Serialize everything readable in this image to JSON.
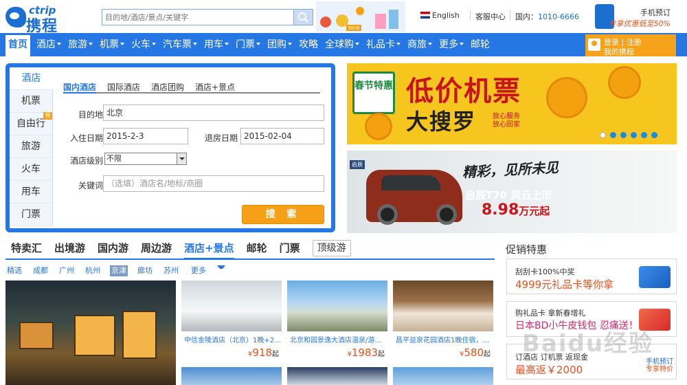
{
  "header": {
    "logo_top": "ctrip",
    "logo_main": "携程",
    "search_placeholder": "目的地/酒店/景点/关键字",
    "new_badge": "NEW",
    "language": "English",
    "service": "客服中心",
    "phone_label": "国内：",
    "phone_number": "1010-6666",
    "mobile_title": "手机预订",
    "mobile_promo": "专享优惠低至50%"
  },
  "nav": {
    "items": [
      {
        "label": "首页",
        "dropdown": false
      },
      {
        "label": "酒店",
        "dropdown": true
      },
      {
        "label": "旅游",
        "dropdown": true
      },
      {
        "label": "机票",
        "dropdown": true
      },
      {
        "label": "火车",
        "dropdown": true
      },
      {
        "label": "汽车票",
        "dropdown": true
      },
      {
        "label": "用车",
        "dropdown": true
      },
      {
        "label": "门票",
        "dropdown": true
      },
      {
        "label": "团购",
        "dropdown": true
      },
      {
        "label": "攻略",
        "dropdown": false
      },
      {
        "label": "全球购",
        "dropdown": true
      },
      {
        "label": "礼品卡",
        "dropdown": true
      },
      {
        "label": "商旅",
        "dropdown": true
      },
      {
        "label": "更多",
        "dropdown": true
      },
      {
        "label": "邮轮",
        "dropdown": false
      }
    ],
    "login": "登录 | 注册",
    "my_ctrip": "我的携程"
  },
  "booking": {
    "vertical_tabs": [
      "酒店",
      "机票",
      "自由行",
      "旅游",
      "火车",
      "用车",
      "门票"
    ],
    "save_tag": "省",
    "tabs": [
      "国内酒店",
      "国际酒店",
      "酒店团购",
      "酒店+景点"
    ],
    "destination_label": "目的地",
    "destination_value": "北京",
    "checkin_label": "入住日期",
    "checkin_value": "2015-2-3",
    "checkout_label": "退房日期",
    "checkout_value": "2015-02-04",
    "level_label": "酒店级别",
    "level_value": "不限",
    "keyword_label": "关键词",
    "keyword_placeholder": "（选填）酒店名/地标/商圈",
    "search_button": "搜 索"
  },
  "banner1": {
    "badge": "春节特惠",
    "title": "低价机票",
    "subtitle": "大搜罗",
    "slogan1": "放心服务",
    "slogan2": "放心回家",
    "active_dot": 0,
    "dots": 6
  },
  "banner2": {
    "brand": "启辰",
    "headline": "精彩，见所未见",
    "model": "启辰T70 风云上市",
    "price": "8.98",
    "price_unit": "万元起"
  },
  "lower": {
    "tabs": [
      "特卖汇",
      "出境游",
      "国内游",
      "周边游",
      "酒店+景点",
      "邮轮",
      "门票",
      "顶级游"
    ],
    "cities": [
      "精选",
      "成都",
      "广州",
      "杭州",
      "京津",
      "廊坊",
      "苏州"
    ],
    "more": "更多",
    "cards": [
      {
        "caption": "中信金陵酒店（北京）1晚+2…",
        "price": "918",
        "unit": "起"
      },
      {
        "caption": "北京和园景逸大酒店温泉/游…",
        "price": "1983",
        "unit": "起"
      },
      {
        "caption": "昌平益泉花园酒店1晚住宿，…",
        "price": "580",
        "unit": "起"
      }
    ],
    "currency": "¥"
  },
  "promo": {
    "title": "促销特惠",
    "items": [
      {
        "line1": "刮刮卡100%中奖",
        "line2": "4999元礼品卡等你拿"
      },
      {
        "line1": "购礼品卡 拿新春增礼",
        "line2": "日本BD小牛皮钱包 忍痛送！"
      },
      {
        "line1": "订酒店 订机票 返现金",
        "line2": "最高返￥2000"
      }
    ],
    "mobile_tag": "手机预订",
    "mobile_tag2": "专享特价"
  },
  "watermark": "Baidu经验",
  "colors": {
    "brand": "#2577e3",
    "accent": "#f5a016",
    "price": "#e8501e"
  }
}
